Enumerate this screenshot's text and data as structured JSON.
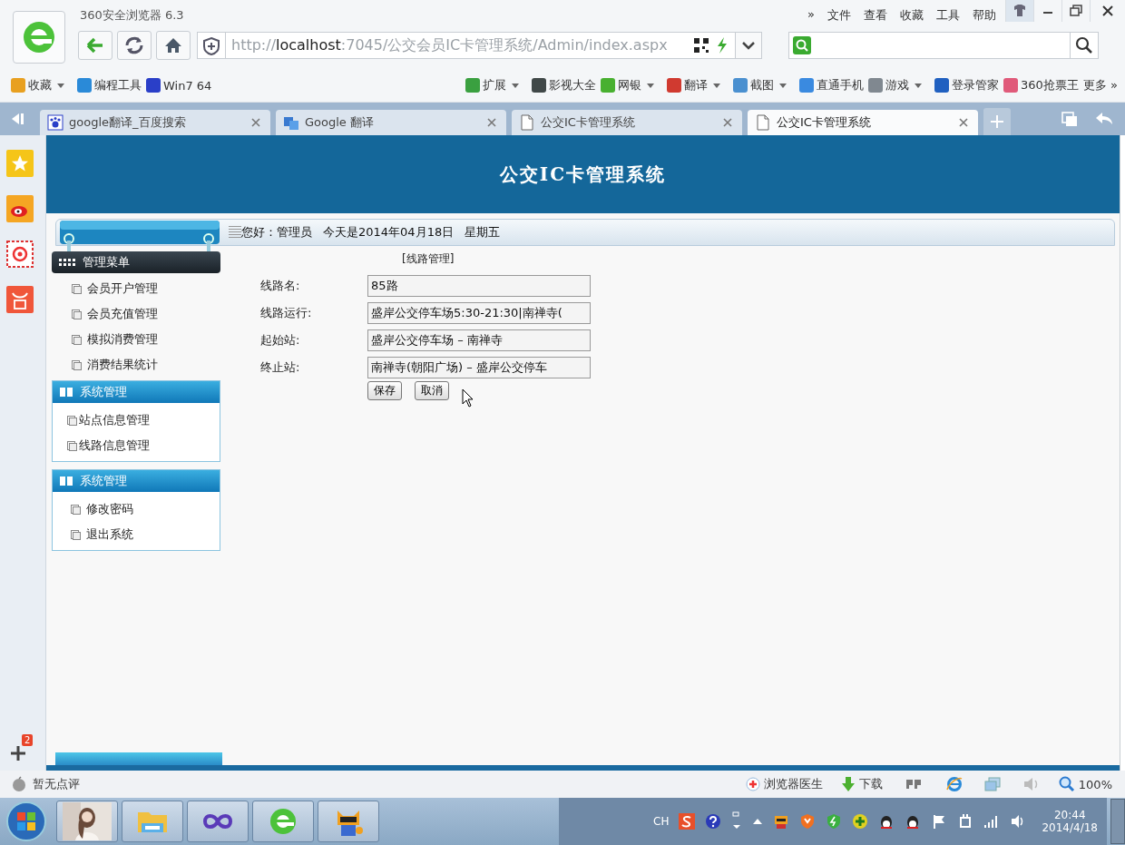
{
  "browser": {
    "title": "360安全浏览器 6.3",
    "menu": [
      "»",
      "文件",
      "查看",
      "收藏",
      "工具",
      "帮助"
    ],
    "address": {
      "scheme": "http://",
      "host": "localhost",
      "rest": ":7045/公交会员IC卡管理系统/Admin/index.aspx"
    },
    "bookmarks_left": [
      {
        "label": "收藏",
        "color": "#e8a020",
        "dropdown": true
      },
      {
        "label": "编程工具",
        "color": "#2a8ad8",
        "dropdown": false
      },
      {
        "label": "Win7 64",
        "color": "#2a3fc8",
        "dropdown": false
      }
    ],
    "bookmarks_right": [
      {
        "label": "扩展",
        "color": "#3aa040",
        "dropdown": true
      },
      {
        "label": "影视大全",
        "color": "#404848",
        "dropdown": false
      },
      {
        "label": "网银",
        "color": "#48b030",
        "dropdown": true
      },
      {
        "label": "翻译",
        "color": "#d03a30",
        "dropdown": true
      },
      {
        "label": "截图",
        "color": "#4a90d0",
        "dropdown": true
      },
      {
        "label": "直通手机",
        "color": "#3a8ae0",
        "dropdown": false
      },
      {
        "label": "游戏",
        "color": "#808890",
        "dropdown": true
      },
      {
        "label": "登录管家",
        "color": "#2060c0",
        "dropdown": false
      },
      {
        "label": "360抢票王",
        "color": "#e05a7a",
        "dropdown": false
      },
      {
        "label": "更多 »",
        "dropdown": false
      }
    ]
  },
  "tabs": [
    {
      "label": "google翻译_百度搜索",
      "selected": false
    },
    {
      "label": "Google 翻译",
      "selected": false
    },
    {
      "label": "公交IC卡管理系统",
      "selected": false
    },
    {
      "label": "公交IC卡管理系统",
      "selected": true
    }
  ],
  "page": {
    "title": "公交IC卡管理系统",
    "greeting": "您好：管理员",
    "date": "今天是2014年04月18日",
    "weekday": "星期五",
    "menu_title": "管理菜单",
    "menu_items": [
      "会员开户管理",
      "会员充值管理",
      "模拟消费管理",
      "消费结果统计"
    ],
    "groups": [
      {
        "title": "系统管理",
        "items": [
          "站点信息管理",
          "线路信息管理"
        ]
      },
      {
        "title": "系统管理",
        "items": [
          "修改密码",
          "退出系统"
        ]
      }
    ],
    "form": {
      "heading": "[线路管理]",
      "fields": [
        {
          "label": "线路名:",
          "value": "85路"
        },
        {
          "label": "线路运行:",
          "value": "盛岸公交停车场5:30-21:30|南禅寺("
        },
        {
          "label": "起始站:",
          "value": "盛岸公交停车场 – 南禅寺"
        },
        {
          "label": "终止站:",
          "value": "南禅寺(朝阳广场) – 盛岸公交停车"
        }
      ],
      "buttons": [
        "保存",
        "取消"
      ]
    }
  },
  "add_badge": "2",
  "status_bar": {
    "rating": "暂无点评",
    "doctor": "浏览器医生",
    "download": "下载",
    "zoom": "100%"
  },
  "taskbar": {
    "lang": "CH",
    "time": "20:44",
    "date": "2014/4/18"
  }
}
